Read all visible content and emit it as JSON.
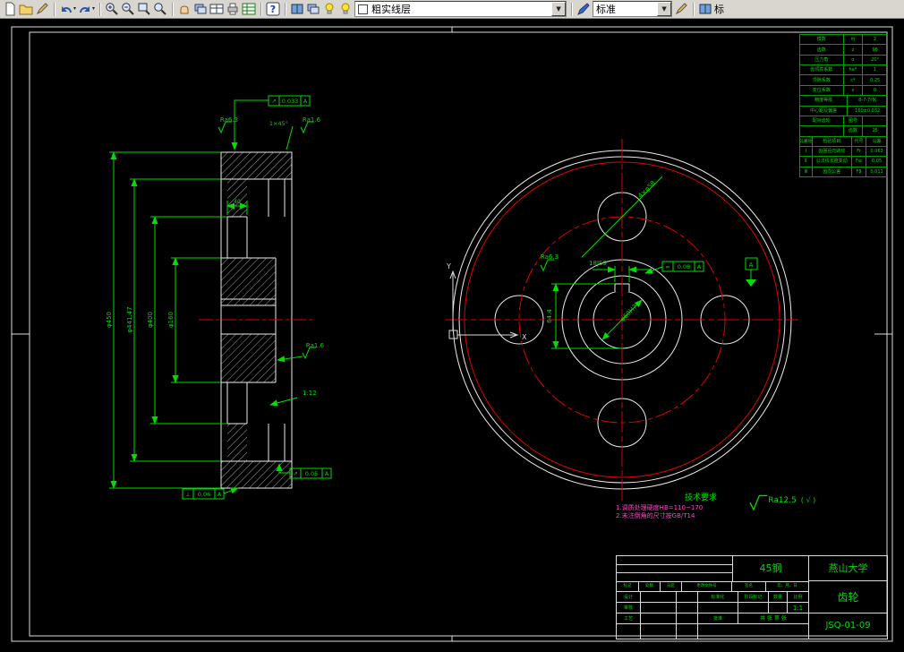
{
  "toolbar": {
    "icons": [
      "new",
      "open",
      "edit",
      "undo",
      "redo",
      "zoom-in",
      "zoom-out",
      "zoom-window",
      "zoom-all",
      "pan",
      "layer-manager",
      "parts-list",
      "plot",
      "spreadsheet",
      "help",
      "sheet-settings",
      "view-manager",
      "layer-on",
      "layer-color",
      "text-style",
      "style-edit"
    ],
    "layer_selector": {
      "value": "粗实线层"
    },
    "style_selector": {
      "value": "标准"
    },
    "clipped_label": "标"
  },
  "colors": {
    "line_white": "#ececec",
    "centerline_red": "#e00000",
    "dimension_green": "#00dd00",
    "note_magenta": "#ff44cc",
    "toolbar_bg": "#d9d6cf"
  },
  "left_view": {
    "dims": [
      "φ450",
      "φ441.47",
      "φ400",
      "φ160"
    ],
    "dim_40": "40",
    "tol_top": {
      "sym": "↗",
      "val": "0.033",
      "datum": "A"
    },
    "tol_bottom1": {
      "sym": "↗",
      "val": "0.05",
      "datum": "A"
    },
    "tol_bottom2": {
      "sym": "⊥",
      "val": "0.06",
      "datum": "A"
    },
    "ra_top_left": "Ra6.3",
    "ra_top_right": "Ra1.6",
    "chamfer": "1×45°",
    "ra_mid": "Ra1.6",
    "taper": "1:12"
  },
  "right_view": {
    "holes_label": "4×φ58",
    "keyway_width": "18JS9",
    "keyway_depth": "64.4",
    "bore": "φ60H7",
    "ra_keyway": "Ra6.3",
    "tol_keyway": {
      "sym": "=",
      "val": "0.08",
      "datum": "A"
    },
    "datum_label": "A",
    "axis_x": "X",
    "axis_y": "Y",
    "ra_general": "Ra12.5",
    "ra_general_suffix": "( √ )"
  },
  "param_table": {
    "rows": [
      [
        "模数",
        "m",
        "2"
      ],
      [
        "齿数",
        "z",
        "98"
      ],
      [
        "压力角",
        "α",
        "20°"
      ],
      [
        "齿顶高系数",
        "ha*",
        "1"
      ],
      [
        "顶隙系数",
        "c*",
        "0.25"
      ],
      [
        "变位系数",
        "x",
        "0"
      ],
      [
        "精度等级",
        "8-7-7HK"
      ],
      [
        "中心距及偏差",
        "160±0.032"
      ],
      [
        "配对齿轮",
        "图号",
        ""
      ],
      [
        "",
        "齿数",
        "25"
      ],
      [
        "公差组",
        "检验项目",
        "代号",
        "公差"
      ],
      [
        "Ⅰ",
        "齿圈径向跳动",
        "Fr",
        "0.063"
      ],
      [
        "Ⅱ",
        "公法线长度变动",
        "Fw",
        "0.05"
      ],
      [
        "Ⅲ",
        "齿向公差",
        "Fβ",
        "0.011"
      ]
    ]
  },
  "tech_requirements": {
    "title": "技术要求",
    "lines": [
      "1.调质处理硬度HB=110~170",
      "2.未注倒角的尺寸按GB/T14"
    ]
  },
  "title_block": {
    "material": "45钢",
    "school": "燕山大学",
    "part_name": "齿轮",
    "drawing_no": "JSQ-01-09",
    "scale": "1:1",
    "labels": {
      "mark": "标记",
      "count": "处数",
      "zone": "分区",
      "change_file": "更改文件号",
      "sign": "签名",
      "date": "年、月、日",
      "design": "设计",
      "check": "审核",
      "process": "工艺",
      "approve": "批准",
      "standardize": "标准化",
      "stage": "阶段标记",
      "qty": "数量",
      "scale_lbl": "比例",
      "sheets": "共 张 第 张"
    }
  }
}
